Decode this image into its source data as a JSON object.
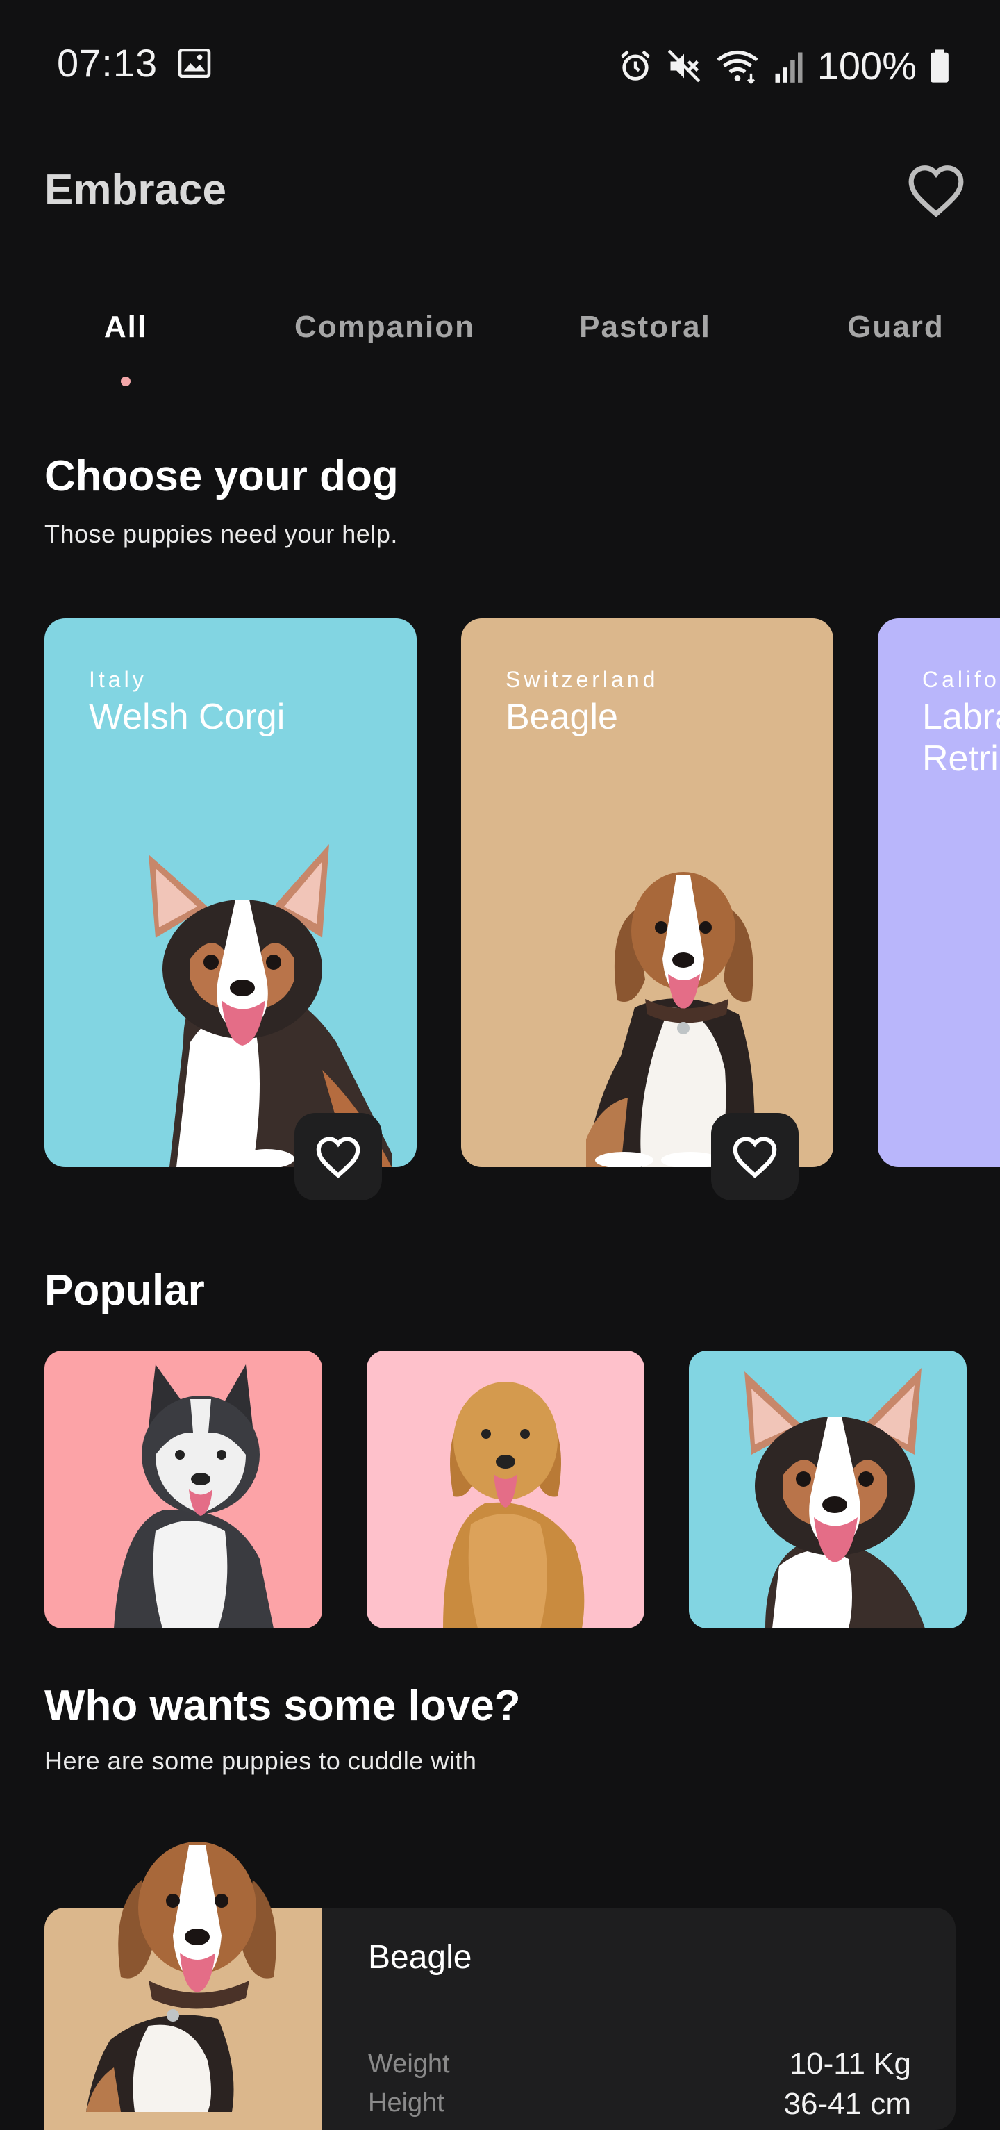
{
  "status": {
    "time": "07:13",
    "battery": "100%"
  },
  "header": {
    "title": "Embrace"
  },
  "tabs": [
    {
      "label": "All",
      "active": true
    },
    {
      "label": "Companion",
      "active": false
    },
    {
      "label": "Pastoral",
      "active": false
    },
    {
      "label": "Guard",
      "active": false
    }
  ],
  "choose": {
    "title": "Choose your dog",
    "subtitle": "Those puppies need your help."
  },
  "cards": [
    {
      "origin": "Italy",
      "name": "Welsh Corgi",
      "color": "#82d5e2"
    },
    {
      "origin": "Switzerland",
      "name": "Beagle",
      "color": "#dbb78c"
    },
    {
      "origin": "Califo",
      "name": "Labra Retrie",
      "color": "#b9b6fb"
    }
  ],
  "popular": {
    "title": "Popular",
    "items": [
      {
        "icon": "husky-photo",
        "color": "#fca3a7"
      },
      {
        "icon": "golden-retriever-photo",
        "color": "#fec1cb"
      },
      {
        "icon": "corgi-photo",
        "color": "#82d5e2"
      }
    ]
  },
  "love": {
    "title": "Who wants some love?",
    "subtitle": "Here are some puppies to cuddle with",
    "item": {
      "name": "Beagle",
      "weight_label": "Weight",
      "weight_value": "10-11 Kg",
      "height_label": "Height",
      "height_value": "36-41 cm"
    }
  }
}
